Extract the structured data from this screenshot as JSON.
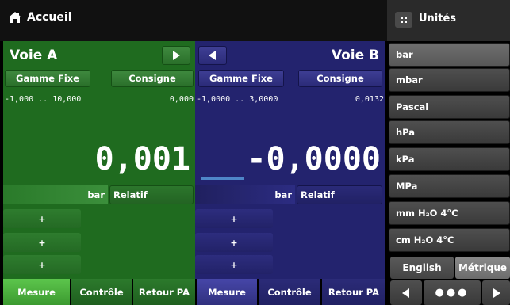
{
  "header": {
    "home_label": "Accueil"
  },
  "channel_a": {
    "title": "Voie A",
    "range_button": "Gamme Fixe",
    "setpoint_button": "Consigne",
    "range_text": "-1,000 .. 10,000",
    "setpoint_value": "0,000",
    "reading": "0,001",
    "unit": "bar",
    "mode": "Relatif",
    "plus_buttons": [
      "+",
      "+",
      "+"
    ],
    "tabs": [
      "Mesure",
      "Contrôle",
      "Retour PA"
    ]
  },
  "channel_b": {
    "title": "Voie B",
    "range_button": "Gamme Fixe",
    "setpoint_button": "Consigne",
    "range_text": "-1,0000 .. 3,0000",
    "setpoint_value": "0,0132",
    "reading": "-0,0000",
    "unit": "bar",
    "mode": "Relatif",
    "plus_buttons": [
      "+",
      "+",
      "+"
    ],
    "tabs": [
      "Mesure",
      "Contrôle",
      "Retour PA"
    ]
  },
  "units_panel": {
    "title": "Unités",
    "items": [
      "bar",
      "mbar",
      "Pascal",
      "hPa",
      "kPa",
      "MPa",
      "mm H₂O 4°C",
      "cm H₂O 4°C"
    ],
    "selected": "bar",
    "language_buttons": [
      "English",
      "Métrique"
    ],
    "pager_dots": "●●●"
  },
  "colors": {
    "channel_a_bg": "#1f6b1f",
    "channel_b_bg": "#23236e",
    "active_tab": "#4caf3c",
    "units_bg": "#3f3f3f"
  }
}
